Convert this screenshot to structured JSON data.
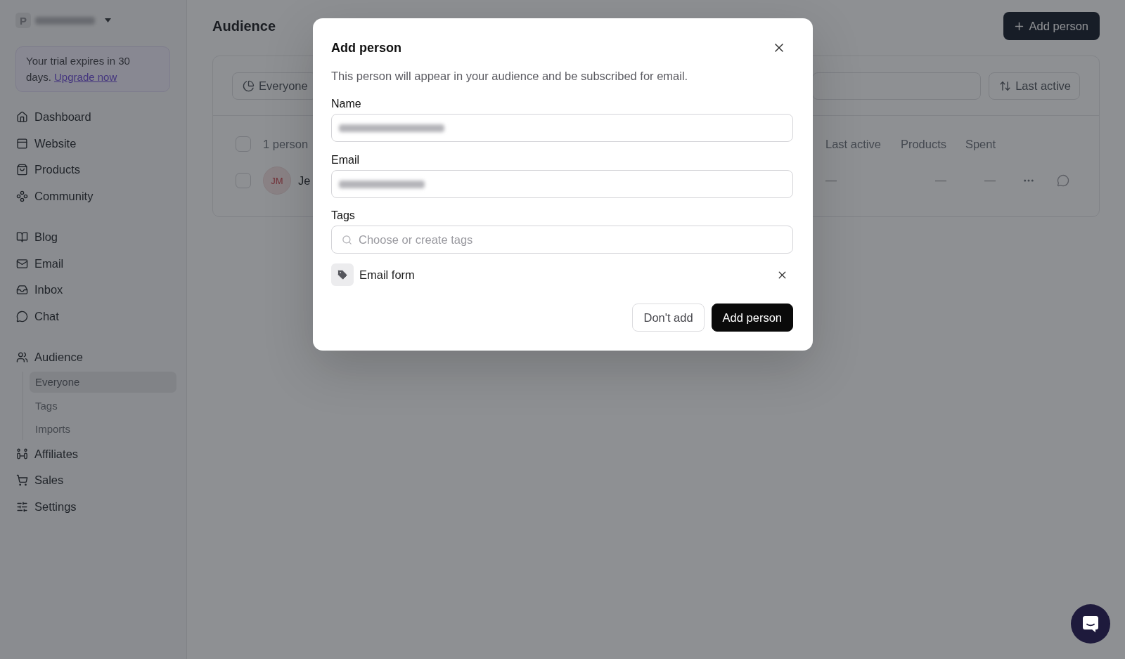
{
  "workspace": {
    "initial": "P"
  },
  "trial_banner": {
    "text": "Your trial expires in 30 days.",
    "link": "Upgrade now"
  },
  "sidebar": {
    "sections": [
      {
        "items": [
          {
            "label": "Dashboard",
            "selected": false
          },
          {
            "label": "Website",
            "selected": false
          },
          {
            "label": "Products",
            "selected": false
          },
          {
            "label": "Community",
            "selected": false
          }
        ]
      },
      {
        "items": [
          {
            "label": "Blog",
            "selected": false
          },
          {
            "label": "Email",
            "selected": false
          },
          {
            "label": "Inbox",
            "selected": false
          },
          {
            "label": "Chat",
            "selected": false
          }
        ]
      },
      {
        "items": [
          {
            "label": "Audience",
            "selected": false,
            "children": [
              {
                "label": "Everyone",
                "selected": true
              },
              {
                "label": "Tags",
                "selected": false
              },
              {
                "label": "Imports",
                "selected": false
              }
            ]
          },
          {
            "label": "Affiliates",
            "selected": false
          },
          {
            "label": "Sales",
            "selected": false
          },
          {
            "label": "Settings",
            "selected": false
          }
        ]
      }
    ]
  },
  "page": {
    "title": "Audience",
    "add_button": "Add person"
  },
  "audience": {
    "segment_button": "Everyone",
    "sort_button": "Last active",
    "table": {
      "count": "1 person",
      "all_checked": false,
      "columns": [
        "Last active",
        "Products",
        "Spent"
      ],
      "rows": [
        {
          "checked": false,
          "initials": "JM",
          "name": "Je",
          "cells": [
            "—",
            "—",
            "—"
          ]
        }
      ]
    }
  },
  "modal": {
    "title": "Add person",
    "description": "This person will appear in your audience and be subscribed for email.",
    "fields": [
      {
        "label": "Name",
        "value_blurred": true
      },
      {
        "label": "Email",
        "value_blurred": true
      }
    ],
    "tags": {
      "label": "Tags",
      "placeholder": "Choose or create tags",
      "items": [
        {
          "label": "Email form"
        }
      ]
    },
    "buttons": [
      {
        "label": "Don't add",
        "kind": "secondary"
      },
      {
        "label": "Add person",
        "kind": "primary"
      }
    ]
  }
}
